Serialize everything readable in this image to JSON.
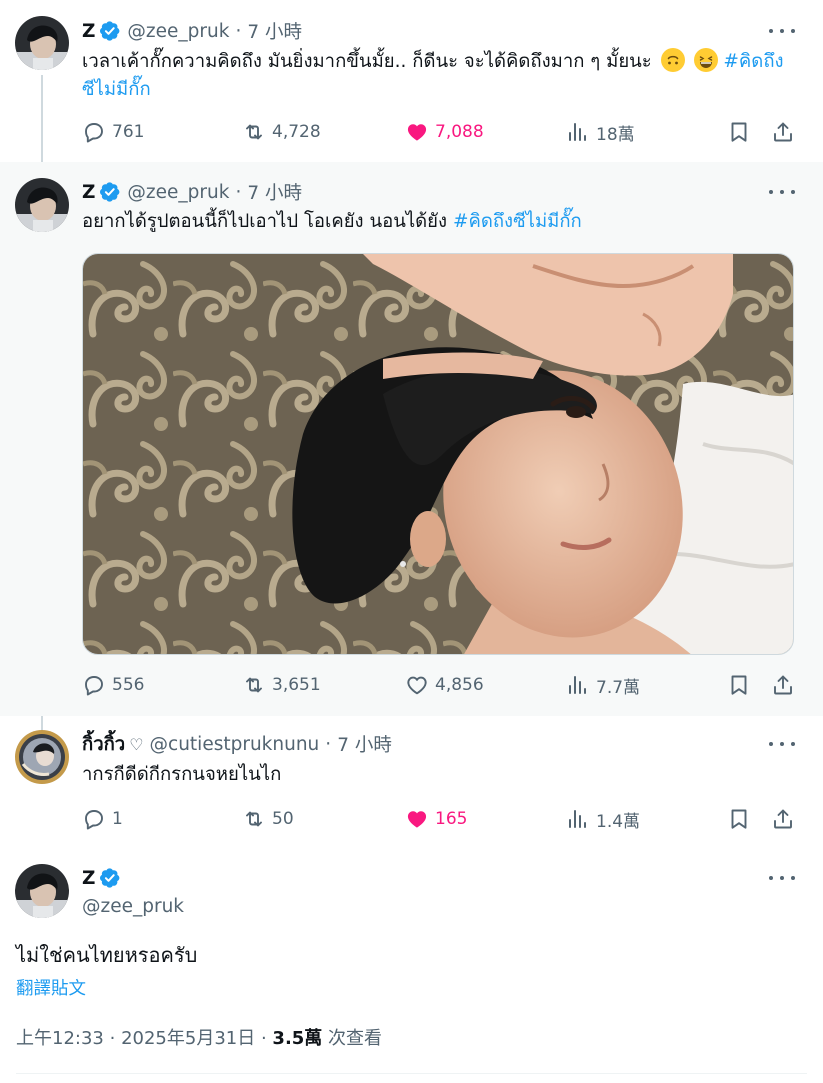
{
  "tweets": [
    {
      "name": "Z",
      "verified": true,
      "handle": "@zee_pruk",
      "separator": "·",
      "time": "7 小時",
      "text": "เวลาเค้ากั๊กความคิดถึง มันยิ่งมากขึ้นมั้ย.. ก็ดีนะ จะได้คิดถึงมาก ๆ มั้ยนะ",
      "emojis": [
        "upside-down-face-emoji",
        "grinning-squinting-face-emoji"
      ],
      "hashtag_line1": "#คิดถึง",
      "hashtag_line2": "ซีไม่มีกั๊ก",
      "replies": "761",
      "reposts": "4,728",
      "likes": "7,088",
      "liked": true,
      "views": "18萬"
    },
    {
      "name": "Z",
      "verified": true,
      "handle": "@zee_pruk",
      "separator": "·",
      "time": "7 小時",
      "text": "อยากได้รูปตอนนี้ก็ไปเอาไป โอเคยัง นอนได้ยัง",
      "hashtag": "#คิดถึงซีไม่มีกั๊ก",
      "image": "selfie-photo",
      "replies": "556",
      "reposts": "3,651",
      "likes": "4,856",
      "liked": false,
      "views": "7.7萬"
    },
    {
      "name": "กิ้วกิ้ว",
      "name_suffix": "♡",
      "verified": false,
      "handle": "@cutiestpruknunu",
      "separator": "·",
      "time": "7 小時",
      "text": "าก​ร​ก​ี​ด​ี​ด​่​ก​ี​ก​ร​ก​น​จ​ห​ย​ไ​น​ไ​ก",
      "replies": "1",
      "reposts": "50",
      "likes": "165",
      "liked": true,
      "views": "1.4萬"
    }
  ],
  "main_tweet": {
    "name": "Z",
    "verified": true,
    "handle": "@zee_pruk",
    "text": "ไม่ใช่คนไทยหรอครับ",
    "translate_label": "翻譯貼文",
    "time": "上午12:33",
    "date": "2025年5月31日",
    "separator": "·",
    "views_count": "3.5萬",
    "views_label": "次查看"
  },
  "icons": {
    "reply": "reply-icon",
    "repost": "repost-icon",
    "like": "heart-icon",
    "views": "analytics-icon",
    "bookmark": "bookmark-icon",
    "share": "share-icon",
    "more": "more-icon",
    "verified": "verified-badge-icon"
  },
  "colors": {
    "accent": "#1d9bf0",
    "like": "#f91880",
    "muted": "#536471",
    "text": "#0f1419",
    "highlight_bg": "#f7f9f9"
  }
}
